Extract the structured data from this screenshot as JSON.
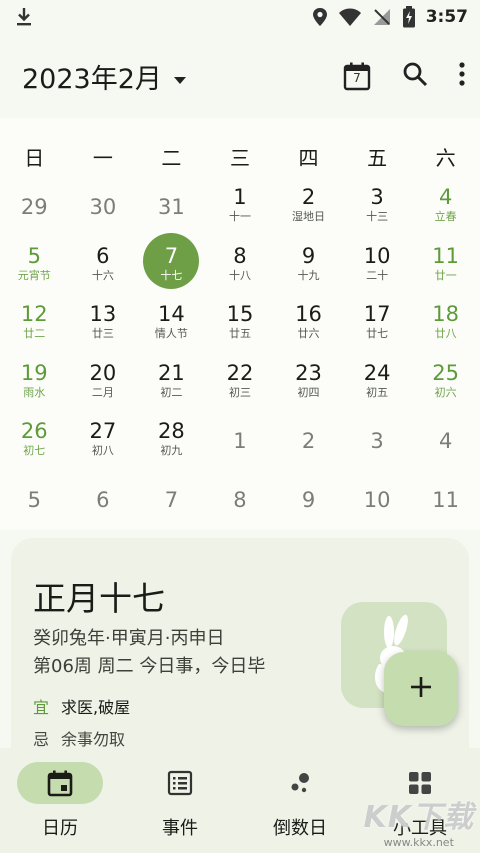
{
  "status": {
    "time": "3:57"
  },
  "header": {
    "title": "2023年2月",
    "calendar_badge": "7"
  },
  "weekdays": [
    "日",
    "一",
    "二",
    "三",
    "四",
    "五",
    "六"
  ],
  "weeks": [
    [
      {
        "d": "29",
        "l": ""
      },
      {
        "d": "30",
        "l": ""
      },
      {
        "d": "31",
        "l": ""
      },
      {
        "d": "1",
        "l": "十一"
      },
      {
        "d": "2",
        "l": "湿地日"
      },
      {
        "d": "3",
        "l": "十三"
      },
      {
        "d": "4",
        "l": "立春"
      }
    ],
    [
      {
        "d": "5",
        "l": "元宵节"
      },
      {
        "d": "6",
        "l": "十六"
      },
      {
        "d": "7",
        "l": "十七"
      },
      {
        "d": "8",
        "l": "十八"
      },
      {
        "d": "9",
        "l": "十九"
      },
      {
        "d": "10",
        "l": "二十"
      },
      {
        "d": "11",
        "l": "廿一"
      }
    ],
    [
      {
        "d": "12",
        "l": "廿二"
      },
      {
        "d": "13",
        "l": "廿三"
      },
      {
        "d": "14",
        "l": "情人节"
      },
      {
        "d": "15",
        "l": "廿五"
      },
      {
        "d": "16",
        "l": "廿六"
      },
      {
        "d": "17",
        "l": "廿七"
      },
      {
        "d": "18",
        "l": "廿八"
      }
    ],
    [
      {
        "d": "19",
        "l": "雨水"
      },
      {
        "d": "20",
        "l": "二月"
      },
      {
        "d": "21",
        "l": "初二"
      },
      {
        "d": "22",
        "l": "初三"
      },
      {
        "d": "23",
        "l": "初四"
      },
      {
        "d": "24",
        "l": "初五"
      },
      {
        "d": "25",
        "l": "初六"
      }
    ],
    [
      {
        "d": "26",
        "l": "初七"
      },
      {
        "d": "27",
        "l": "初八"
      },
      {
        "d": "28",
        "l": "初九"
      },
      {
        "d": "1",
        "l": ""
      },
      {
        "d": "2",
        "l": ""
      },
      {
        "d": "3",
        "l": ""
      },
      {
        "d": "4",
        "l": ""
      }
    ],
    [
      {
        "d": "5",
        "l": ""
      },
      {
        "d": "6",
        "l": ""
      },
      {
        "d": "7",
        "l": ""
      },
      {
        "d": "8",
        "l": ""
      },
      {
        "d": "9",
        "l": ""
      },
      {
        "d": "10",
        "l": ""
      },
      {
        "d": "11",
        "l": ""
      }
    ]
  ],
  "detail": {
    "lunar_date": "正月十七",
    "ganzhi": "癸卯兔年·甲寅月·丙申日",
    "week_info": "第06周 周二 今日事，今日毕",
    "yi_label": "宜",
    "yi_value": "求医,破屋",
    "ji_label": "忌",
    "ji_value": "余事勿取"
  },
  "nav": [
    {
      "label": "日历",
      "icon": "calendar-icon"
    },
    {
      "label": "事件",
      "icon": "list-icon"
    },
    {
      "label": "倒数日",
      "icon": "bubbles-icon"
    },
    {
      "label": "小工具",
      "icon": "grid-icon"
    }
  ],
  "watermark": {
    "brand": "KK下载",
    "url": "www.kkx.net"
  },
  "colors": {
    "accent": "#6e9f46",
    "accent_light": "#c4dcae",
    "weekend": "#5d9a3a"
  }
}
